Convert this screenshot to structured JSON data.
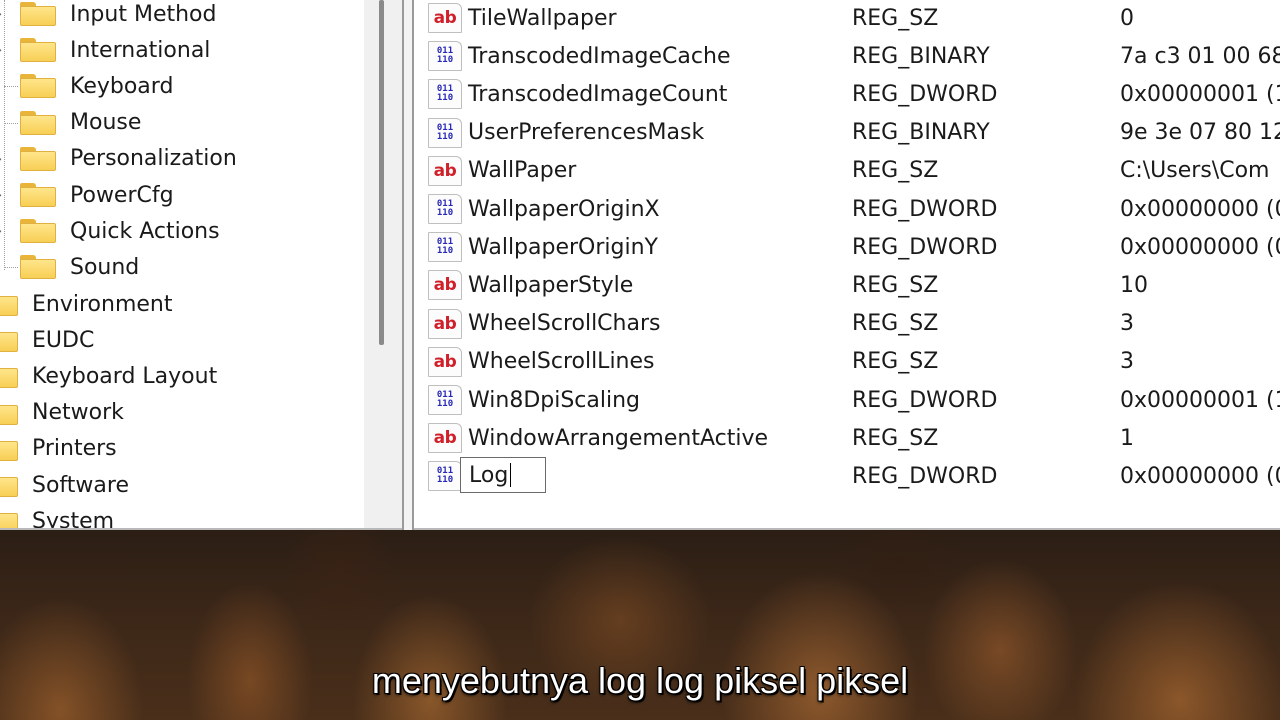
{
  "tree": {
    "child_items": [
      {
        "label": "Input Method",
        "expandable": true
      },
      {
        "label": "International",
        "expandable": true
      },
      {
        "label": "Keyboard",
        "expandable": false
      },
      {
        "label": "Mouse",
        "expandable": false
      },
      {
        "label": "Personalization",
        "expandable": true
      },
      {
        "label": "PowerCfg",
        "expandable": true
      },
      {
        "label": "Quick Actions",
        "expandable": true
      },
      {
        "label": "Sound",
        "expandable": false
      }
    ],
    "root_items": [
      {
        "label": "Environment"
      },
      {
        "label": "EUDC"
      },
      {
        "label": "Keyboard Layout"
      },
      {
        "label": "Network"
      },
      {
        "label": "Printers"
      },
      {
        "label": "Software"
      },
      {
        "label": "System"
      }
    ]
  },
  "values": {
    "rows": [
      {
        "icon": "string-value-icon",
        "kind": "sz",
        "name": "TileWallpaper",
        "type": "REG_SZ",
        "data": "0"
      },
      {
        "icon": "binary-value-icon",
        "kind": "bin",
        "name": "TranscodedImageCache",
        "type": "REG_BINARY",
        "data": "7a c3 01 00 68"
      },
      {
        "icon": "binary-value-icon",
        "kind": "bin",
        "name": "TranscodedImageCount",
        "type": "REG_DWORD",
        "data": "0x00000001 (1"
      },
      {
        "icon": "binary-value-icon",
        "kind": "bin",
        "name": "UserPreferencesMask",
        "type": "REG_BINARY",
        "data": "9e 3e 07 80 12"
      },
      {
        "icon": "string-value-icon",
        "kind": "sz",
        "name": "WallPaper",
        "type": "REG_SZ",
        "data": "C:\\Users\\Com"
      },
      {
        "icon": "binary-value-icon",
        "kind": "bin",
        "name": "WallpaperOriginX",
        "type": "REG_DWORD",
        "data": "0x00000000 (0"
      },
      {
        "icon": "binary-value-icon",
        "kind": "bin",
        "name": "WallpaperOriginY",
        "type": "REG_DWORD",
        "data": "0x00000000 (0"
      },
      {
        "icon": "string-value-icon",
        "kind": "sz",
        "name": "WallpaperStyle",
        "type": "REG_SZ",
        "data": "10"
      },
      {
        "icon": "string-value-icon",
        "kind": "sz",
        "name": "WheelScrollChars",
        "type": "REG_SZ",
        "data": "3"
      },
      {
        "icon": "string-value-icon",
        "kind": "sz",
        "name": "WheelScrollLines",
        "type": "REG_SZ",
        "data": "3"
      },
      {
        "icon": "binary-value-icon",
        "kind": "bin",
        "name": "Win8DpiScaling",
        "type": "REG_DWORD",
        "data": "0x00000001 (1"
      },
      {
        "icon": "string-value-icon",
        "kind": "sz",
        "name": "WindowArrangementActive",
        "type": "REG_SZ",
        "data": "1"
      }
    ],
    "editing_row": {
      "icon": "binary-value-icon",
      "kind": "bin",
      "name_input_value": "Log",
      "type": "REG_DWORD",
      "data": "0x00000000 (0"
    }
  },
  "icons": {
    "sz_glyph": "ab",
    "bin_glyph_top": "011",
    "bin_glyph_bottom": "110",
    "expander_glyph": "›"
  },
  "subtitle": {
    "text": "menyebutnya log log piksel piksel"
  }
}
